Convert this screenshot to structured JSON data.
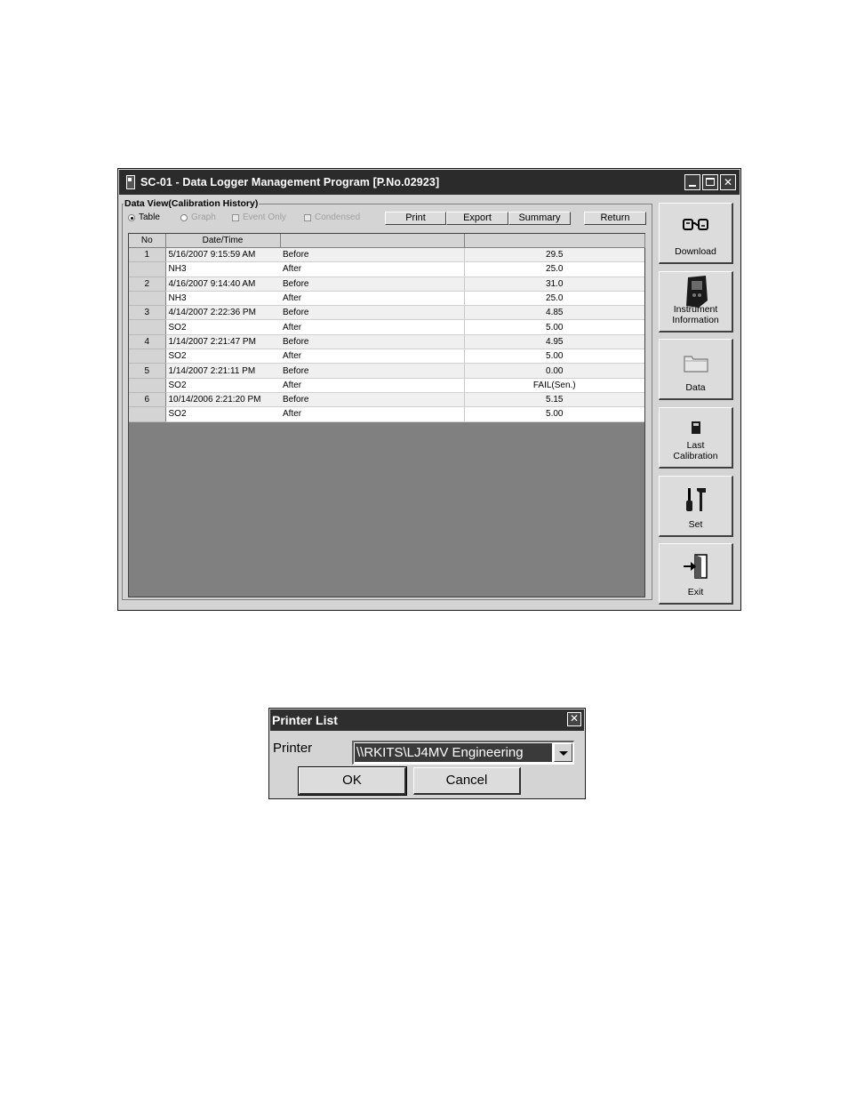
{
  "window": {
    "title": "SC-01 - Data Logger Management Program [P.No.02923]"
  },
  "data_view": {
    "group_label": "Data View(Calibration History)",
    "options": {
      "table": "Table",
      "graph": "Graph",
      "event_only": "Event Only",
      "condensed": "Condensed"
    },
    "buttons": {
      "print": "Print",
      "export": "Export",
      "summary": "Summary",
      "return": "Return"
    },
    "columns": [
      "No",
      "Date/Time",
      "",
      ""
    ],
    "rows": [
      {
        "no": "1",
        "datetime": "5/16/2007 9:15:59 AM",
        "state": "Before",
        "value": "29.5"
      },
      {
        "no": "",
        "datetime": "NH3",
        "state": "After",
        "value": "25.0"
      },
      {
        "no": "2",
        "datetime": "4/16/2007 9:14:40 AM",
        "state": "Before",
        "value": "31.0"
      },
      {
        "no": "",
        "datetime": "NH3",
        "state": "After",
        "value": "25.0"
      },
      {
        "no": "3",
        "datetime": "4/14/2007 2:22:36 PM",
        "state": "Before",
        "value": "4.85"
      },
      {
        "no": "",
        "datetime": "SO2",
        "state": "After",
        "value": "5.00"
      },
      {
        "no": "4",
        "datetime": "1/14/2007 2:21:47 PM",
        "state": "Before",
        "value": "4.95"
      },
      {
        "no": "",
        "datetime": "SO2",
        "state": "After",
        "value": "5.00"
      },
      {
        "no": "5",
        "datetime": "1/14/2007 2:21:11 PM",
        "state": "Before",
        "value": "0.00"
      },
      {
        "no": "",
        "datetime": "SO2",
        "state": "After",
        "value": "FAIL(Sen.)"
      },
      {
        "no": "6",
        "datetime": "10/14/2006 2:21:20 PM",
        "state": "Before",
        "value": "5.15"
      },
      {
        "no": "",
        "datetime": "SO2",
        "state": "After",
        "value": "5.00"
      }
    ]
  },
  "side_panel": {
    "download": "Download",
    "instrument_line1": "Instrument",
    "instrument_line2": "Information",
    "data": "Data",
    "last_cal_line1": "Last",
    "last_cal_line2": "Calibration",
    "set": "Set",
    "exit": "Exit"
  },
  "printer_dialog": {
    "title": "Printer List",
    "label": "Printer",
    "selected_printer": "\\\\RKITS\\LJ4MV Engineering",
    "ok": "OK",
    "cancel": "Cancel"
  }
}
